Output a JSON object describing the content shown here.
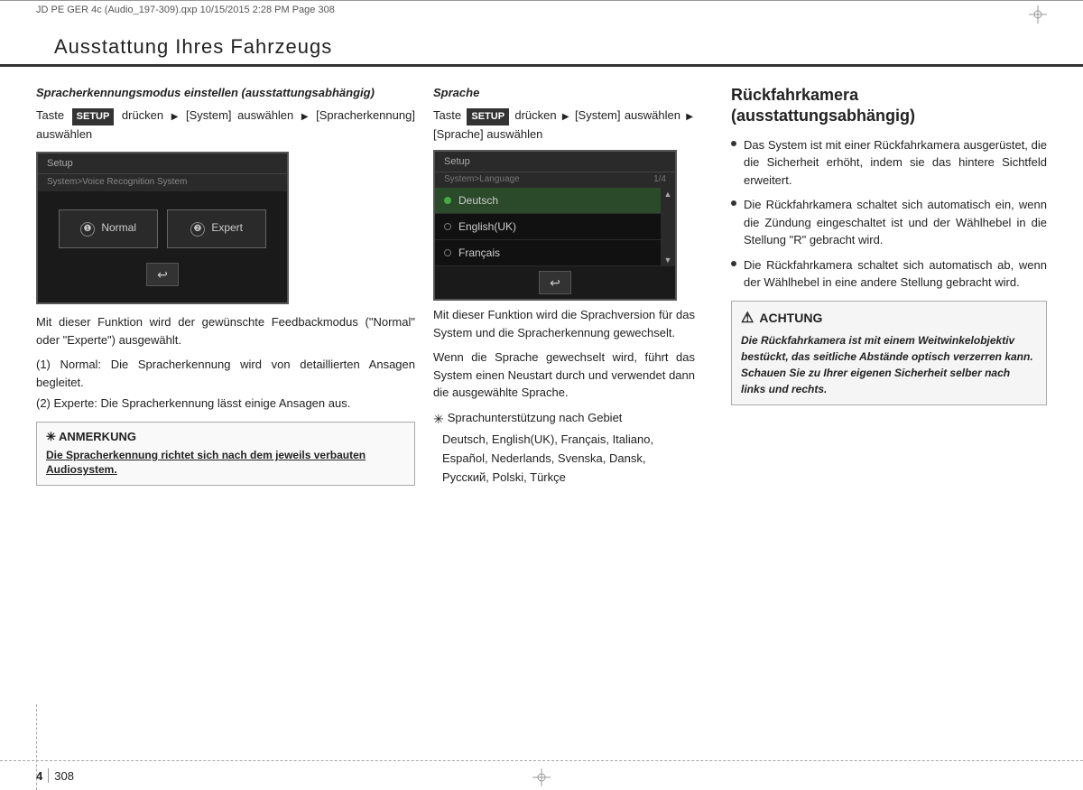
{
  "header": {
    "left_text": "JD PE GER 4c (Audio_197-309).qxp   10/15/2015  2:28 PM  Page 308"
  },
  "section_title": "Ausstattung Ihres Fahrzeugs",
  "col_left": {
    "heading": "Spracherkennungsmodus einstellen (ausstattungsabhängig)",
    "setup_label": "SETUP",
    "arrow": "▶",
    "system_label": "[System]",
    "auswahlen_label": "auswählen",
    "spracherk_label": "[Spracherkennung]",
    "auswahlen2": "auswählen",
    "ui_title": "Setup",
    "ui_subtitle": "System>Voice Recognition System",
    "ui_num1": "❶",
    "ui_num2": "❷",
    "ui_opt1": "Normal",
    "ui_opt2": "Expert",
    "ui_back_symbol": "↩",
    "body1": "Mit dieser Funktion wird der gewünschte Feedbackmodus (\"Normal\" oder \"Experte\") ausgewählt.",
    "num_list": [
      "(1) Normal: Die Spracherkennung wird von detaillierten Ansagen begleitet.",
      "(2) Experte: Die Spracherkennung lässt einige Ansagen aus."
    ],
    "note_symbol": "✳ ANMERKUNG",
    "note_text": "Die Spracherkennung richtet sich nach dem jeweils verbauten Audiosystem."
  },
  "col_middle": {
    "heading": "Sprache",
    "setup_label": "SETUP",
    "arrow": "▶",
    "system_label": "[System]",
    "auswahlen_label": "auswählen",
    "arrow2": "▶",
    "sprache_label": "[Sprache] auswählen",
    "ui_title": "Setup",
    "ui_subtitle": "System>Language",
    "ui_page": "1/4",
    "ui_items": [
      "Deutsch",
      "English(UK)",
      "Français"
    ],
    "ui_back_symbol": "↩",
    "body1": "Mit dieser Funktion wird die Sprachversion für das System und die Spracherkennung gewechselt.",
    "body2": "Wenn die Sprache gewechselt wird, führt das System einen Neustart durch und verwendet dann die ausgewählte Sprache.",
    "lang_support_heading": "✳ Sprachunterstützung nach Gebiet",
    "lang_support_list": "Deutsch, English(UK), Français, Italiano, Español, Nederlands, Svenska, Dansk, Русский, Polski, Türkçe"
  },
  "col_right": {
    "heading_line1": "Rückfahrkamera",
    "heading_line2": "(ausstattungsabhängig)",
    "bullets": [
      "Das System ist mit einer Rückfahrkamera ausgerüstet, die die Sicherheit erhöht, indem sie das hintere Sichtfeld erweitert.",
      "Die Rückfahrkamera schaltet sich automatisch ein, wenn die Zündung eingeschaltet ist und der Wählhebel in die Stellung \"R\" gebracht wird.",
      "Die Rückfahrkamera schaltet sich automatisch ab, wenn der Wählhebel in eine andere Stellung gebracht wird."
    ],
    "warning_symbol": "⚠",
    "warning_heading": "ACHTUNG",
    "warning_text": "Die Rückfahrkamera ist mit einem Weitwinkelobjektiv bestückt, das seitliche Abstände optisch verzerren kann. Schauen Sie zu Ihrer eigenen Sicherheit selber nach links und rechts."
  },
  "footer": {
    "page_num": "4",
    "page_num2": "308"
  }
}
